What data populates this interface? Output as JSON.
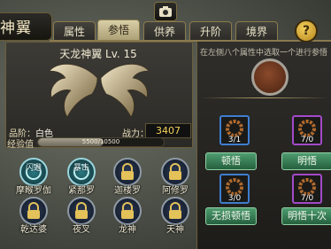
{
  "header": {
    "title": "神翼",
    "tabs": [
      {
        "label": "属性",
        "active": false
      },
      {
        "label": "参悟",
        "active": true
      },
      {
        "label": "供养",
        "active": false
      },
      {
        "label": "升阶",
        "active": false
      },
      {
        "label": "境界",
        "active": false
      }
    ],
    "help_symbol": "?",
    "camera_icon": "camera-icon"
  },
  "wing": {
    "name_level": "天龙神翼 Lv. 15",
    "quality_label": "品阶：",
    "quality_value": "白色",
    "power_label": "战力：",
    "power_value": "3407",
    "exp_label": "经验值",
    "exp_text": "5500/10500",
    "exp_fraction": 0.524
  },
  "skills": [
    {
      "name": "摩睺罗伽",
      "badge": "闪避",
      "state": "unlocked"
    },
    {
      "name": "紧那罗",
      "badge": "暴击",
      "state": "unlocked"
    },
    {
      "name": "迦楼罗",
      "badge": "",
      "state": "locked"
    },
    {
      "name": "阿修罗",
      "badge": "",
      "state": "locked"
    },
    {
      "name": "乾达婆",
      "badge": "",
      "state": "locked"
    },
    {
      "name": "夜叉",
      "badge": "",
      "state": "locked"
    },
    {
      "name": "龙神",
      "badge": "",
      "state": "locked"
    },
    {
      "name": "天神",
      "badge": "",
      "state": "locked"
    }
  ],
  "right": {
    "hint": "在左侧八个属性中选取一个进行参悟",
    "items": [
      {
        "count": "3/1",
        "button": "顿悟",
        "frame": "blue"
      },
      {
        "count": "7/0",
        "button": "明悟",
        "frame": "purple"
      },
      {
        "count": "3/0",
        "button": "无损顿悟",
        "frame": "blue"
      },
      {
        "count": "7/0",
        "button": "明悟十次",
        "frame": "purple"
      }
    ]
  },
  "colors": {
    "accent_gold": "#f4d25b",
    "button_green": "#3f8a5c",
    "tab_active": "#d9cfa8"
  }
}
